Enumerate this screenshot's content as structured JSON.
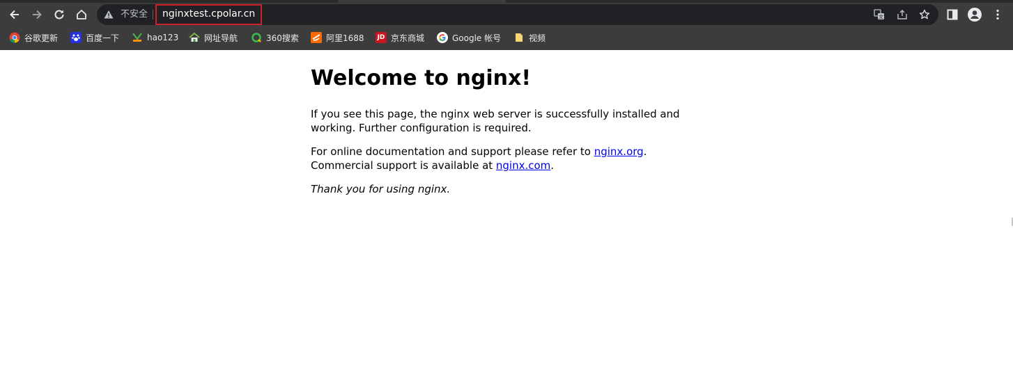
{
  "browser": {
    "security_label": "不安全",
    "url": "nginxtest.cpolar.cn",
    "icons": [
      "back-arrow-icon",
      "forward-arrow-icon",
      "reload-icon",
      "home-icon",
      "warning-icon",
      "translate-icon",
      "share-icon",
      "star-icon",
      "side-panel-icon",
      "profile-icon",
      "kebab-menu-icon"
    ],
    "colors": {
      "chrome": "#3c3c3c",
      "omnibox": "#202124",
      "url_highlight": "#d0202a"
    }
  },
  "bookmarks": [
    {
      "label": "谷歌更新",
      "icon": "chrome-icon"
    },
    {
      "label": "百度一下",
      "icon": "baidu-icon"
    },
    {
      "label": "hao123",
      "icon": "hao123-icon"
    },
    {
      "label": "网址导航",
      "icon": "house-icon"
    },
    {
      "label": "360搜索",
      "icon": "360-search-icon"
    },
    {
      "label": "阿里1688",
      "icon": "ali1688-icon"
    },
    {
      "label": "京东商城",
      "icon": "jd-icon"
    },
    {
      "label": "Google 帐号",
      "icon": "google-icon"
    },
    {
      "label": "视频",
      "icon": "folder-icon"
    }
  ],
  "page": {
    "title": "Welcome to nginx!",
    "para1_line1": "If you see this page, the nginx web server is successfully installed and",
    "para1_line2": "working. Further configuration is required.",
    "para2_line1_text": "For online documentation and support please refer to ",
    "para2_link1": "nginx.org",
    "para2_line1_end": ".",
    "para2_line2_text": "Commercial support is available at ",
    "para2_link2": "nginx.com",
    "para2_line2_end": ".",
    "thanks": "Thank you for using nginx.",
    "colors": {
      "link": "#0000ee",
      "text": "#000000"
    }
  }
}
